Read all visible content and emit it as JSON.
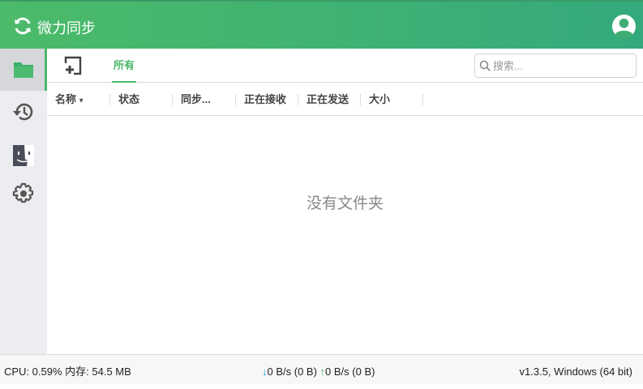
{
  "app": {
    "title": "微力同步"
  },
  "toolbar": {
    "tab_all": "所有",
    "search_placeholder": "搜索..."
  },
  "columns": [
    "名称",
    "状态",
    "同步...",
    "正在接收",
    "正在发送",
    "大小"
  ],
  "sort_indicator": "▾",
  "empty_message": "没有文件夹",
  "status": {
    "cpu_mem": "CPU: 0.59% 内存: 54.5 MB",
    "download_arrow": "↓",
    "download": "0 B/s (0 B)",
    "upload_arrow": "↑",
    "upload": "0 B/s (0 B)",
    "version": "v1.3.5, Windows (64 bit)"
  },
  "colors": {
    "accent": "#4cb86b",
    "download": "#1aa1e0"
  }
}
